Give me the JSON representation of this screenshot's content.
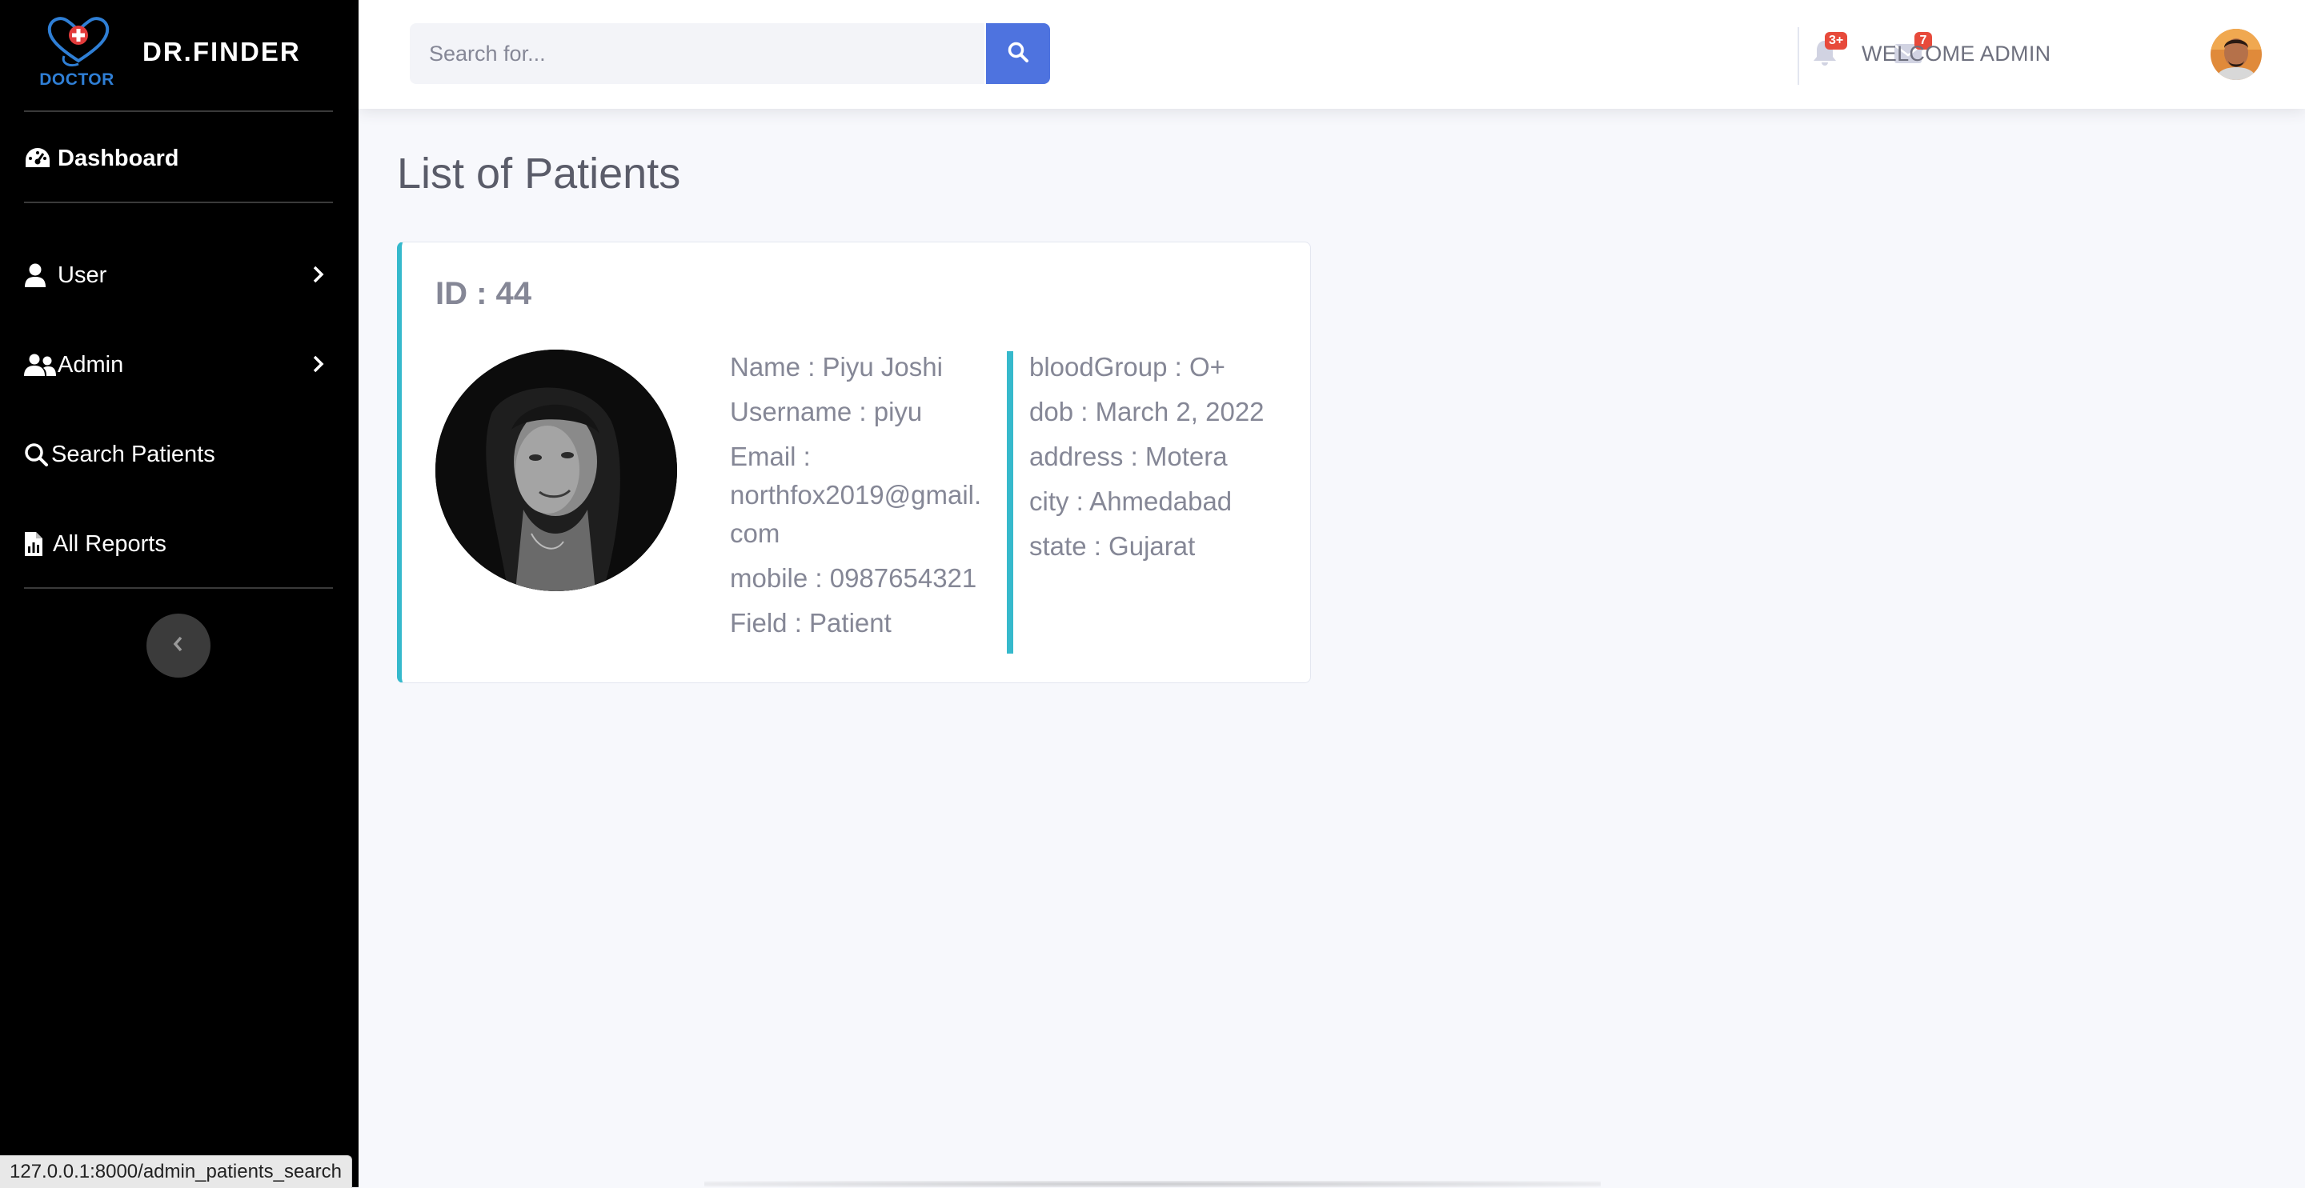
{
  "brand": {
    "logo_text": "DOCTOR",
    "name": "DR.FINDER"
  },
  "sidebar": {
    "items": [
      {
        "label": "Dashboard",
        "icon": "gauge-icon",
        "has_chevron": false
      },
      {
        "label": "User",
        "icon": "user-icon",
        "has_chevron": true
      },
      {
        "label": "Admin",
        "icon": "users-icon",
        "has_chevron": true
      },
      {
        "label": "Search Patients",
        "icon": "search-icon",
        "has_chevron": false
      },
      {
        "label": "All Reports",
        "icon": "report-icon",
        "has_chevron": false
      }
    ],
    "toggle_icon": "chevron-left-icon"
  },
  "topbar": {
    "search": {
      "placeholder": "Search for...",
      "value": ""
    },
    "alerts_badge": "3+",
    "messages_badge": "7",
    "welcome": "WELCOME ADMIN"
  },
  "main": {
    "title": "List of Patients",
    "patient": {
      "id_label": "ID : 44",
      "name": "Name : Piyu Joshi",
      "username": "Username : piyu",
      "email_label": "Email :",
      "email_line1": "northfox2019@gmail.",
      "email_line2": "com",
      "mobile": "mobile : 0987654321",
      "field": "Field : Patient",
      "blood_group": "bloodGroup : O+",
      "dob": "dob : March 2, 2022",
      "address": "address : Motera",
      "city": "city : Ahmedabad",
      "state": "state : Gujarat"
    }
  },
  "status_bar": {
    "url": "127.0.0.1:8000/admin_patients_search"
  },
  "colors": {
    "sidebar": "#000000",
    "accent": "#4e73df",
    "card_border": "#36b9cc",
    "badge": "#e74a3b"
  }
}
